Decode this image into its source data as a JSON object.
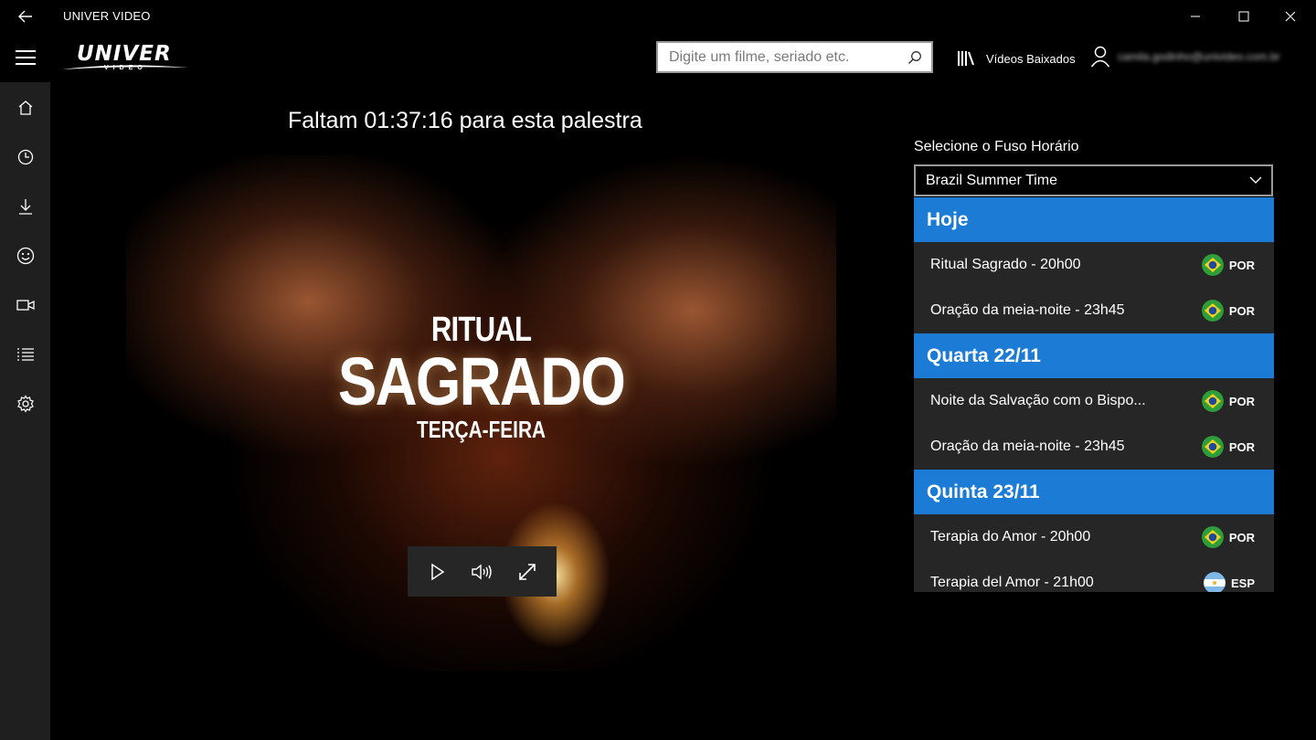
{
  "window": {
    "title": "UNIVER VIDEO"
  },
  "header": {
    "logo": {
      "main": "UNIVER",
      "sub": "VIDEO"
    },
    "search_placeholder": "Digite um filme, seriado etc.",
    "downloads_label": "Vídeos Baixados",
    "user_email": "camila.godinho@univideo.com.br"
  },
  "nav": [
    "home-icon",
    "clock-icon",
    "download-icon",
    "smile-icon",
    "video-camera-icon",
    "list-icon",
    "settings-icon"
  ],
  "main": {
    "countdown": "Faltam 01:37:16 para esta palestra",
    "poster": {
      "line1": "RITUAL",
      "line2": "SAGRADO",
      "line3": "TERÇA-FEIRA"
    }
  },
  "timezone": {
    "label": "Selecione o Fuso Horário",
    "selected": "Brazil Summer Time"
  },
  "schedule": [
    {
      "day": "Hoje",
      "items": [
        {
          "title": "Ritual Sagrado - 20h00",
          "lang": "POR",
          "flag": "brazil"
        },
        {
          "title": "Oração da meia-noite - 23h45",
          "lang": "POR",
          "flag": "brazil"
        }
      ]
    },
    {
      "day": "Quarta 22/11",
      "items": [
        {
          "title": "Noite da Salvação com o Bispo...",
          "lang": "POR",
          "flag": "brazil"
        },
        {
          "title": "Oração da meia-noite - 23h45",
          "lang": "POR",
          "flag": "brazil"
        }
      ]
    },
    {
      "day": "Quinta 23/11",
      "items": [
        {
          "title": "Terapia do Amor  - 20h00",
          "lang": "POR",
          "flag": "brazil"
        },
        {
          "title": "Terapia del Amor  - 21h00",
          "lang": "ESP",
          "flag": "argentina"
        }
      ]
    }
  ],
  "colors": {
    "accent": "#1c7cd5",
    "panel": "#262626",
    "nav": "#1f1f1f"
  }
}
